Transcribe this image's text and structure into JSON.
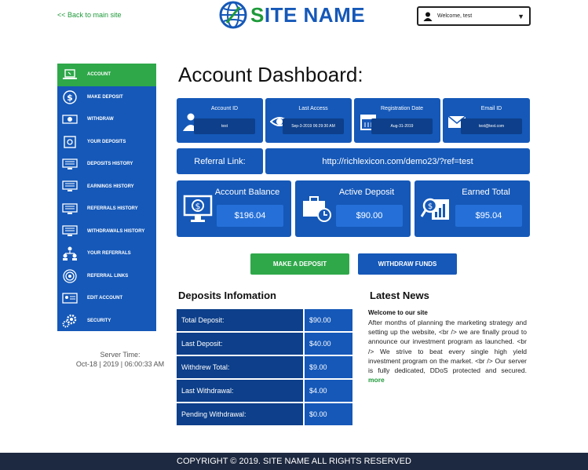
{
  "header": {
    "back_link": "<<  Back to main site",
    "site_name_first": "S",
    "site_name_rest": "ITE NAME",
    "user_welcome": "Welcome, test"
  },
  "sidebar": {
    "items": [
      {
        "label": "ACCOUNT",
        "icon": "laptop-icon"
      },
      {
        "label": "MAKE DEPOSIT",
        "icon": "dollar-coin-icon"
      },
      {
        "label": "WITHDRAW",
        "icon": "cash-icon"
      },
      {
        "label": "YOUR DEPOSITS",
        "icon": "safe-icon"
      },
      {
        "label": "DEPOSITS HISTORY",
        "icon": "monitor-list-icon"
      },
      {
        "label": "EARNINGS HISTORY",
        "icon": "monitor-list-icon"
      },
      {
        "label": "REFERRALS HISTORY",
        "icon": "monitor-list-icon"
      },
      {
        "label": "WITHDRAWALS HISTORY",
        "icon": "monitor-list-icon"
      },
      {
        "label": "YOUR REFERRALS",
        "icon": "users-icon"
      },
      {
        "label": "REFERRAL LINKS",
        "icon": "target-icon"
      },
      {
        "label": "EDIT ACCOUNT",
        "icon": "id-card-icon"
      },
      {
        "label": "SECURITY",
        "icon": "gears-icon"
      }
    ],
    "server_time_label": "Server Time:",
    "server_time_value": "Oct-18 | 2019 | 06:00:33 AM"
  },
  "main": {
    "title": "Account Dashboard:",
    "info_cards": [
      {
        "label": "Account ID",
        "value": "test",
        "icon": "user-icon"
      },
      {
        "label": "Last Access",
        "value": "Sep-3-2019 06:29:30 AM",
        "icon": "eye-icon"
      },
      {
        "label": "Registration Date",
        "value": "Aug-31-2019",
        "icon": "calendar-icon"
      },
      {
        "label": "Email ID",
        "value": "test@test.com",
        "icon": "envelope-icon"
      }
    ],
    "referral_label": "Referral Link:",
    "referral_url": "http://richlexicon.com/demo23/?ref=test",
    "stats": [
      {
        "label": "Account Balance",
        "value": "$196.04",
        "icon": "monitor-dollar-icon"
      },
      {
        "label": "Active Deposit",
        "value": "$90.00",
        "icon": "briefcase-clock-icon"
      },
      {
        "label": "Earned Total",
        "value": "$95.04",
        "icon": "magnifier-chart-icon"
      }
    ],
    "make_deposit_button": "MAKE A DEPOSIT",
    "withdraw_button": "WITHDRAW FUNDS",
    "deposits_title": "Deposits Infomation",
    "deposits": [
      {
        "label": "Total Deposit:",
        "value": "$90.00"
      },
      {
        "label": "Last Deposit:",
        "value": "$40.00"
      },
      {
        "label": "Withdrew Total:",
        "value": "$9.00"
      },
      {
        "label": "Last Withdrawal:",
        "value": "$4.00"
      },
      {
        "label": "Pending Withdrawal:",
        "value": "$0.00"
      }
    ],
    "news_title": "Latest News",
    "news_headline": "Welcome to our site",
    "news_text": "After months of planning the marketing strategy and setting up the website, <br /> we are finally proud to announce our investment program as launched. <br /> We strive to beat every single high yield investment program on the market. <br /> Our server is fully dedicated, DDoS protected and secured. ",
    "news_more": "more"
  },
  "footer": {
    "copyright": "COPYRIGHT © 2019. SITE NAME ALL RIGHTS RESERVED"
  },
  "colors": {
    "primary_blue": "#1558b8",
    "dark_blue": "#0d3f8a",
    "accent_green": "#2fa84a",
    "footer_bg": "#1d2940"
  }
}
